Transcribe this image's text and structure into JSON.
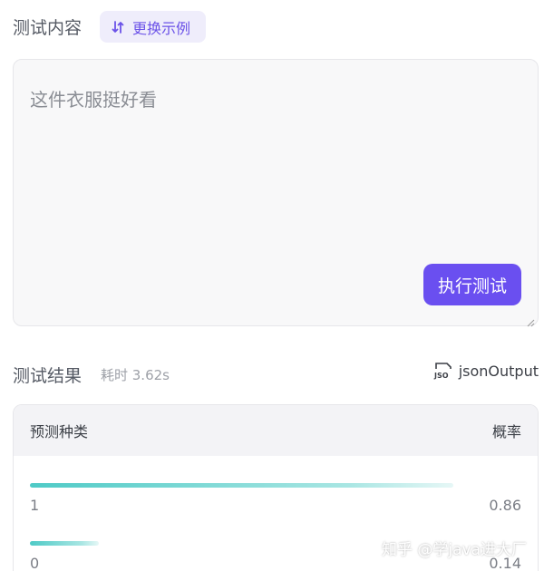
{
  "test_section": {
    "title": "测试内容",
    "swap_button_label": "更换示例",
    "input_text": "这件衣服挺好看",
    "run_button_label": "执行测试"
  },
  "result_section": {
    "title": "测试结果",
    "elapsed": "耗时 3.62s",
    "json_output_label": "jsonOutput",
    "columns": [
      "预测种类",
      "概率"
    ],
    "rows": [
      {
        "label": "1",
        "probability": "0.86",
        "fraction": 0.86
      },
      {
        "label": "0",
        "probability": "0.14",
        "fraction": 0.14
      }
    ]
  },
  "watermark": "知乎 @学java进大厂",
  "colors": {
    "accent": "#6a4ff0",
    "bar": "#4ecac6"
  }
}
